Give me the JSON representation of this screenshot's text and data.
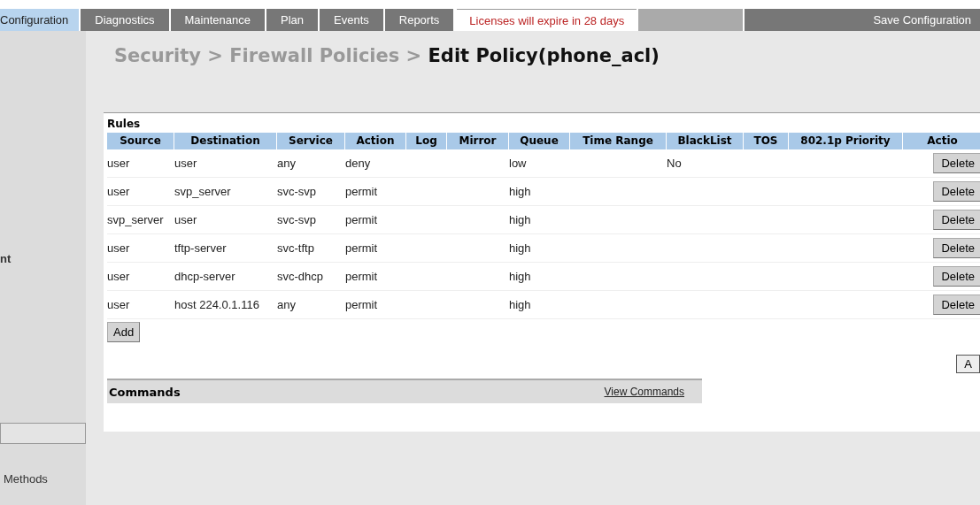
{
  "tabs": [
    {
      "label": "Configuration",
      "selected": true
    },
    {
      "label": "Diagnostics",
      "selected": false
    },
    {
      "label": "Maintenance",
      "selected": false
    },
    {
      "label": "Plan",
      "selected": false
    },
    {
      "label": "Events",
      "selected": false
    },
    {
      "label": "Reports",
      "selected": false
    }
  ],
  "license_notice": "Licenses will expire in 28 days",
  "save_button": "Save Configuration",
  "sidebar": {
    "items": [
      "nt",
      "Methods"
    ]
  },
  "breadcrumb": {
    "parts": [
      "Security",
      ">",
      "Firewall Policies",
      ">"
    ],
    "current": "Edit Policy(phone_acl)"
  },
  "rules": {
    "title": "Rules",
    "columns": [
      "Source",
      "Destination",
      "Service",
      "Action",
      "Log",
      "Mirror",
      "Queue",
      "Time Range",
      "BlackList",
      "TOS",
      "802.1p Priority",
      "Actio"
    ],
    "rows": [
      {
        "source": "user",
        "destination": "user",
        "service": "any",
        "action": "deny",
        "queue": "low",
        "blacklist": "No",
        "button": "Delete"
      },
      {
        "source": "user",
        "destination": "svp_server",
        "service": "svc-svp",
        "action": "permit",
        "queue": "high",
        "button": "Delete"
      },
      {
        "source": "svp_server",
        "destination": "user",
        "service": "svc-svp",
        "action": "permit",
        "queue": "high",
        "button": "Delete"
      },
      {
        "source": "user",
        "destination": "tftp-server",
        "service": "svc-tftp",
        "action": "permit",
        "queue": "high",
        "button": "Delete"
      },
      {
        "source": "user",
        "destination": "dhcp-server",
        "service": "svc-dhcp",
        "action": "permit",
        "queue": "high",
        "button": "Delete"
      },
      {
        "source": "user",
        "destination": "host 224.0.1.116",
        "service": "any",
        "action": "permit",
        "queue": "high",
        "button": "Delete"
      }
    ],
    "add_button": "Add"
  },
  "apply_button": "A",
  "commands": {
    "title": "Commands",
    "link": "View Commands"
  }
}
